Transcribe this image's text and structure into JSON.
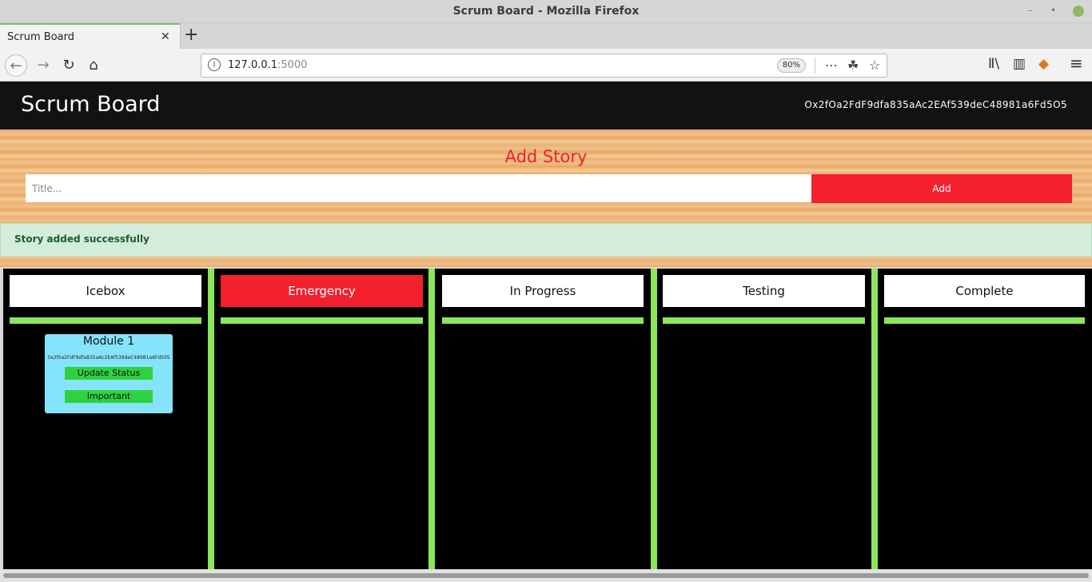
{
  "window": {
    "title": "Scrum Board - Mozilla Firefox",
    "minimize_glyph": "–",
    "maximize_glyph": "•"
  },
  "tab": {
    "title": "Scrum Board",
    "close_glyph": "✕",
    "new_glyph": "+"
  },
  "urlbar": {
    "host": "127.0.0.1",
    "port": ":5000",
    "zoom": "80%"
  },
  "nav_icons": {
    "back": "←",
    "forward": "→",
    "reload": "↻",
    "home": "⌂",
    "menu": "⋯",
    "pocket": "☘",
    "star": "☆",
    "library": "Ⅱ\\",
    "sidebar": "▥",
    "metamask": "◆",
    "hamburger": "≡",
    "info": "i"
  },
  "header": {
    "brand": "Scrum Board",
    "account": "Ox2fOa2FdF9dfa835aAc2EAf539deC48981a6Fd5O5"
  },
  "add_story": {
    "heading": "Add Story",
    "title_placeholder": "Title...",
    "add_label": "Add"
  },
  "alert": {
    "message": "Story added successfully"
  },
  "columns": [
    {
      "label": "Icebox"
    },
    {
      "label": "Emergency"
    },
    {
      "label": "In Progress"
    },
    {
      "label": "Testing"
    },
    {
      "label": "Complete"
    }
  ],
  "card": {
    "title": "Module 1",
    "address": "0x2f0a2FdF9dfa835aAc2EAf539deC48981a6Fd505",
    "update_label": "Update Status",
    "priority_label": "Important"
  },
  "colors": {
    "accent_red": "#f5202e",
    "lane_green": "#8be65a",
    "card_blue": "#85e4fb",
    "button_green": "#2fd23e"
  }
}
